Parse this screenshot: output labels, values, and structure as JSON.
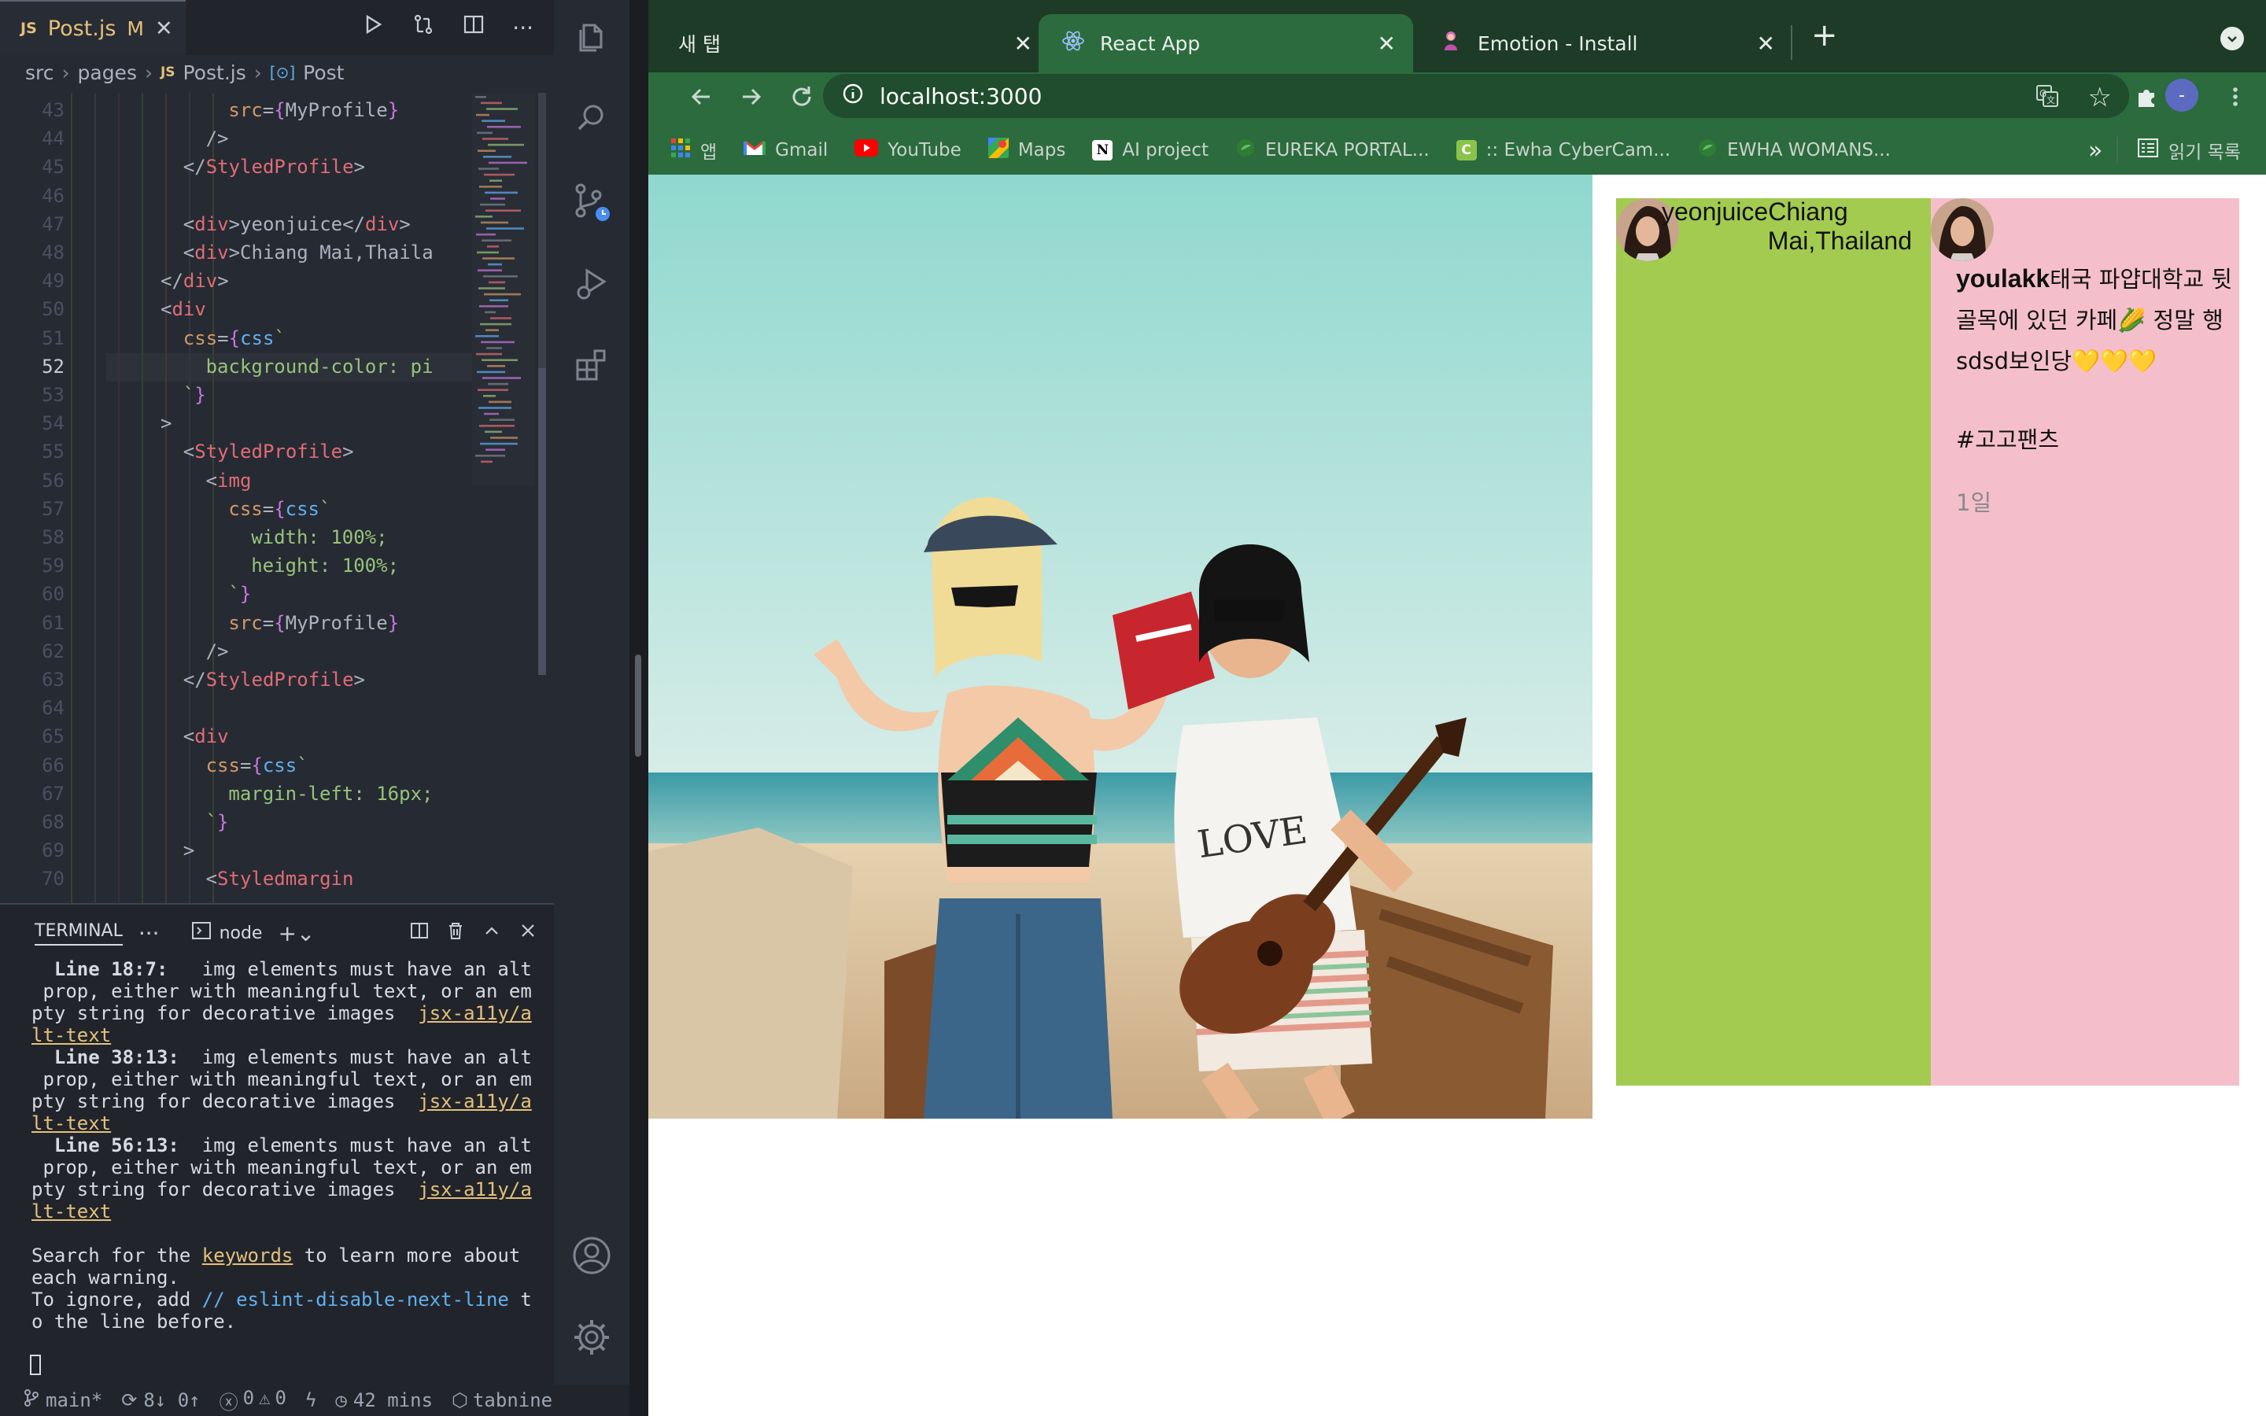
{
  "editor": {
    "tab": {
      "icon": "JS",
      "name": "Post.js",
      "modified": "M",
      "close": "✕"
    },
    "breadcrumb": {
      "src": "src",
      "pages": "pages",
      "icon": "JS",
      "file": "Post.js",
      "symbol_icon": "[⊙]",
      "symbol": "Post"
    },
    "code_lines": [
      {
        "n": "43",
        "html": "<span class=\"at\">src</span><span class=\"pl\">=</span><span class=\"br\">{</span><span class=\"pl\">MyProfile</span><span class=\"br\">}</span>",
        "indent": 8
      },
      {
        "n": "44",
        "html": "<span class=\"pl\">/&gt;</span>",
        "indent": 7
      },
      {
        "n": "45",
        "html": "<span class=\"pl\">&lt;/</span><span class=\"tg\">StyledProfile</span><span class=\"pl\">&gt;</span>",
        "indent": 6
      },
      {
        "n": "46",
        "html": "",
        "indent": 0
      },
      {
        "n": "47",
        "html": "<span class=\"pl\">&lt;</span><span class=\"tg\">div</span><span class=\"pl\">&gt;yeonjuice&lt;/</span><span class=\"tg\">div</span><span class=\"pl\">&gt;</span>",
        "indent": 6
      },
      {
        "n": "48",
        "html": "<span class=\"pl\">&lt;</span><span class=\"tg\">div</span><span class=\"pl\">&gt;Chiang Mai,Thaila</span>",
        "indent": 6
      },
      {
        "n": "49",
        "html": "<span class=\"pl\">&lt;/</span><span class=\"tg\">div</span><span class=\"pl\">&gt;</span>",
        "indent": 5
      },
      {
        "n": "50",
        "html": "<span class=\"pl\">&lt;</span><span class=\"tg\">div</span>",
        "indent": 5
      },
      {
        "n": "51",
        "html": "<span class=\"at\">css</span><span class=\"pl\">=</span><span class=\"br\">{</span><span class=\"bl\">css</span><span class=\"st\">`</span>",
        "indent": 6
      },
      {
        "n": "52",
        "html": "<span class=\"st\">background-color: pi</span>",
        "indent": 7
      },
      {
        "n": "53",
        "html": "<span class=\"st\">`</span><span class=\"br\">}</span>",
        "indent": 6
      },
      {
        "n": "54",
        "html": "<span class=\"pl\">&gt;</span>",
        "indent": 5
      },
      {
        "n": "55",
        "html": "<span class=\"pl\">&lt;</span><span class=\"tg\">StyledProfile</span><span class=\"pl\">&gt;</span>",
        "indent": 6
      },
      {
        "n": "56",
        "html": "<span class=\"pl\">&lt;</span><span class=\"tg\">img</span>",
        "indent": 7
      },
      {
        "n": "57",
        "html": "<span class=\"at\">css</span><span class=\"pl\">=</span><span class=\"br\">{</span><span class=\"bl\">css</span><span class=\"st\">`</span>",
        "indent": 8
      },
      {
        "n": "58",
        "html": "<span class=\"st\">width: 100%;</span>",
        "indent": 9
      },
      {
        "n": "59",
        "html": "<span class=\"st\">height: 100%;</span>",
        "indent": 9
      },
      {
        "n": "60",
        "html": "<span class=\"st\">`</span><span class=\"br\">}</span>",
        "indent": 8
      },
      {
        "n": "61",
        "html": "<span class=\"at\">src</span><span class=\"pl\">=</span><span class=\"br\">{</span><span class=\"pl\">MyProfile</span><span class=\"br\">}</span>",
        "indent": 8
      },
      {
        "n": "62",
        "html": "<span class=\"pl\">/&gt;</span>",
        "indent": 7
      },
      {
        "n": "63",
        "html": "<span class=\"pl\">&lt;/</span><span class=\"tg\">StyledProfile</span><span class=\"pl\">&gt;</span>",
        "indent": 6
      },
      {
        "n": "64",
        "html": "",
        "indent": 0
      },
      {
        "n": "65",
        "html": "<span class=\"pl\">&lt;</span><span class=\"tg\">div</span>",
        "indent": 6
      },
      {
        "n": "66",
        "html": "<span class=\"at\">css</span><span class=\"pl\">=</span><span class=\"br\">{</span><span class=\"bl\">css</span><span class=\"st\">`</span>",
        "indent": 7
      },
      {
        "n": "67",
        "html": "<span class=\"st\">margin-left: 16px;</span>",
        "indent": 8
      },
      {
        "n": "68",
        "html": "<span class=\"st\">`</span><span class=\"br\">}</span>",
        "indent": 7
      },
      {
        "n": "69",
        "html": "<span class=\"pl\">&gt;</span>",
        "indent": 6
      },
      {
        "n": "70",
        "html": "<span class=\"pl\">&lt;</span><span class=\"tg\">Styledmargin</span>",
        "indent": 7
      }
    ],
    "current_line": "52"
  },
  "terminal": {
    "title": "TERMINAL",
    "more": "···",
    "shell": "node",
    "body_html": "  <b>Line 18:7:</b>   img elements must have an alt\n prop, either with meaningful text, or an em\npty string for decorative images  <span class=\"lk\">jsx-a11y/a</span>\n<span class=\"lk\">lt-text</span>\n  <b>Line 38:13:</b>  img elements must have an alt\n prop, either with meaningful text, or an em\npty string for decorative images  <span class=\"lk\">jsx-a11y/a</span>\n<span class=\"lk\">lt-text</span>\n  <b>Line 56:13:</b>  img elements must have an alt\n prop, either with meaningful text, or an em\npty string for decorative images  <span class=\"lk\">jsx-a11y/a</span>\n<span class=\"lk\">lt-text</span>\n\nSearch for the <span class=\"lk\">keywords</span> to learn more about\neach warning.\nTo ignore, add <span class=\"cb\">// eslint-disable-next-line</span> t\no the line before."
  },
  "statusbar": {
    "branch": "main*",
    "sync": "8↓ 0↑",
    "errors": "0",
    "warnings": "0",
    "time": "42 mins",
    "tabnine": "tabnine"
  },
  "browser": {
    "tabs": [
      {
        "title": "새 탭",
        "close": "✕"
      },
      {
        "title": "React App",
        "close": "✕"
      },
      {
        "title": "Emotion - Install",
        "close": "✕"
      }
    ],
    "new_tab": "+",
    "url": "localhost:3000",
    "profile_initial": "-",
    "bookmarks": [
      "앱",
      "Gmail",
      "YouTube",
      "Maps",
      "AI project",
      "EUREKA PORTAL...",
      ":: Ewha CyberCam...",
      "EWHA WOMANS..."
    ],
    "more_bookmarks": "»",
    "reading_list": "읽기 목록"
  },
  "post": {
    "username": "yeonjuice",
    "location_part1": "Chiang",
    "location_part2": "Mai,Thailand",
    "author": "youlakk",
    "caption_line1": "태국 파얍대학교 뒷",
    "caption_line2": "골목에 있던 카페🌽 정말 행",
    "caption_line3": "sdsd보인당💛💛💛",
    "hashtag": "#고고팬츠",
    "age": "1일"
  },
  "colors": {
    "profile_bg": "#a3cb4f",
    "info_bg": "#f4bfcb",
    "chrome_tabstrip": "#1d3b26",
    "chrome_toolbar": "#2c6b3e"
  }
}
